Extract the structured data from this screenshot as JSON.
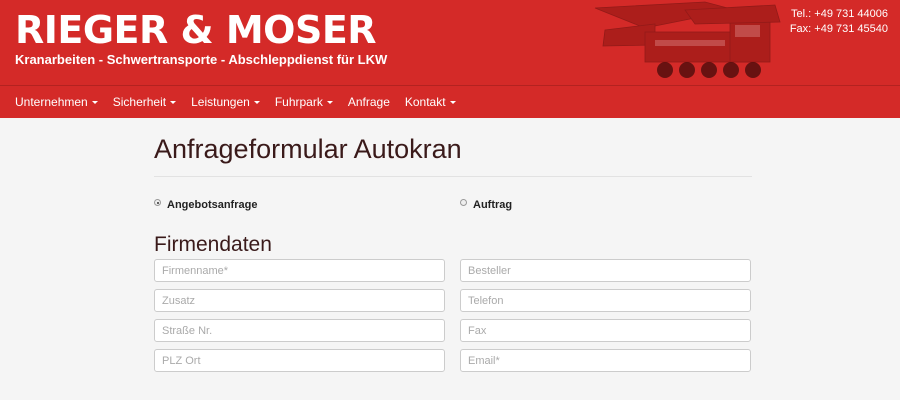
{
  "brand": {
    "name": "RIEGER & MOSER",
    "tagline": "Kranarbeiten - Schwertransporte - Abschleppdienst für LKW",
    "color": "#d42a28"
  },
  "contact": {
    "tel": "Tel.: +49 731 44006",
    "fax": "Fax: +49 731 45540"
  },
  "nav": {
    "items": [
      {
        "label": "Unternehmen",
        "dropdown": true
      },
      {
        "label": "Sicherheit",
        "dropdown": true
      },
      {
        "label": "Leistungen",
        "dropdown": true
      },
      {
        "label": "Fuhrpark",
        "dropdown": true
      },
      {
        "label": "Anfrage",
        "dropdown": false
      },
      {
        "label": "Kontakt",
        "dropdown": true
      }
    ]
  },
  "page": {
    "title": "Anfrageformular Autokran"
  },
  "request_type": {
    "options": [
      {
        "label": "Angebotsanfrage",
        "selected": true
      },
      {
        "label": "Auftrag",
        "selected": false
      }
    ]
  },
  "firmendaten": {
    "title": "Firmendaten",
    "fields": {
      "firmenname": "Firmenname*",
      "besteller": "Besteller",
      "zusatz": "Zusatz",
      "telefon": "Telefon",
      "strasse": "Straße Nr.",
      "fax": "Fax",
      "plz_ort": "PLZ Ort",
      "email": "Email*"
    }
  }
}
